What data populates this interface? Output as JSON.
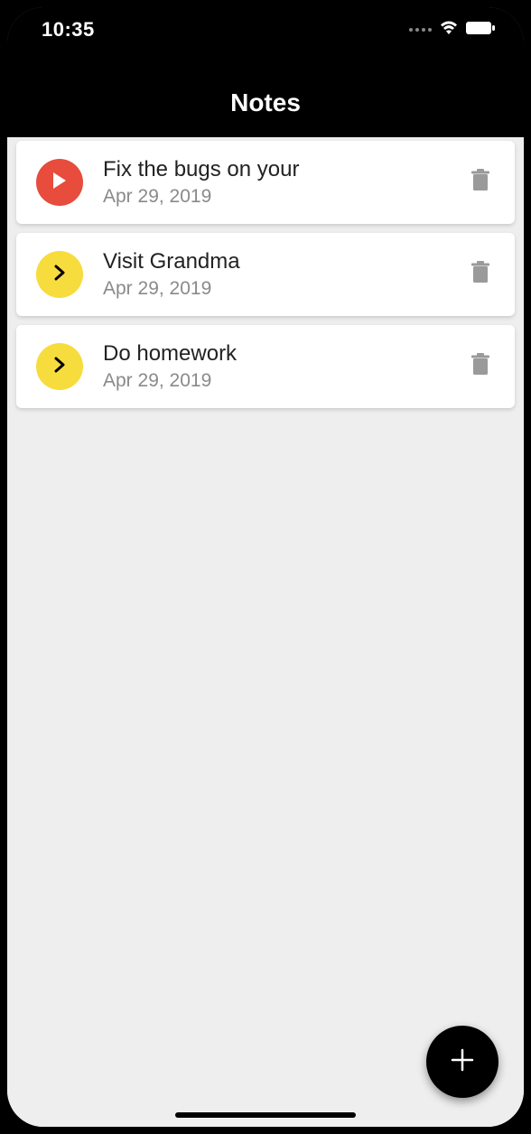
{
  "status": {
    "time": "10:35"
  },
  "header": {
    "title": "Notes"
  },
  "notes": [
    {
      "title": "Fix the bugs on your",
      "date": "Apr 29, 2019",
      "badge_color": "red",
      "icon": "play"
    },
    {
      "title": "Visit Grandma",
      "date": "Apr 29, 2019",
      "badge_color": "yellow",
      "icon": "chevron"
    },
    {
      "title": "Do homework",
      "date": "Apr 29, 2019",
      "badge_color": "yellow",
      "icon": "chevron"
    }
  ],
  "colors": {
    "red": "#e74c3c",
    "yellow": "#f7dc3d",
    "black": "#000000",
    "grey_text": "#8a8a8a"
  }
}
